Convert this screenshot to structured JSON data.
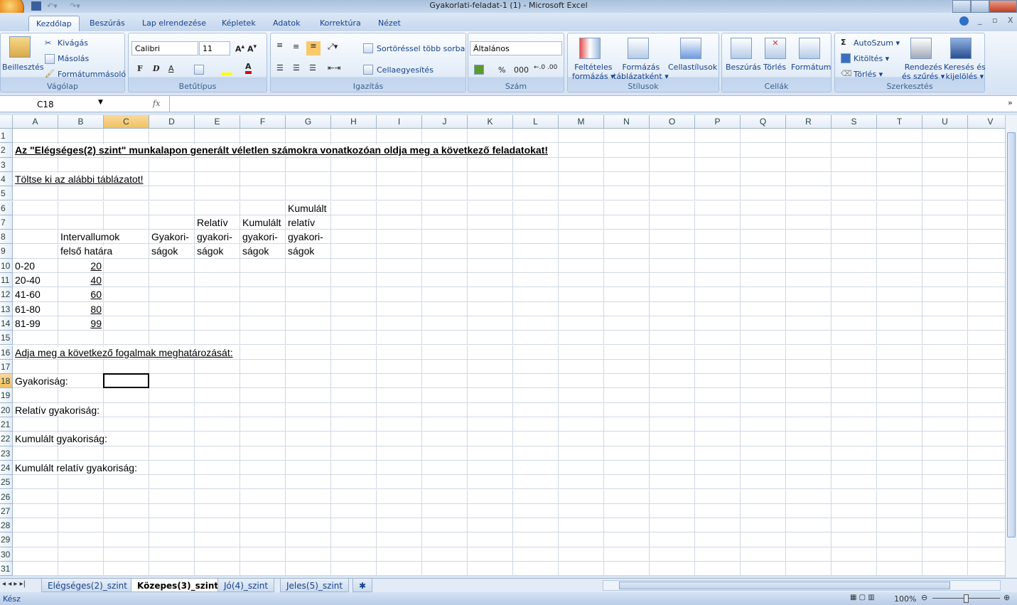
{
  "window": {
    "title": "Gyakorlati-feladat-1 (1) - Microsoft Excel"
  },
  "tabs": [
    {
      "label": "Kezdőlap",
      "active": true
    },
    {
      "label": "Beszúrás"
    },
    {
      "label": "Lap elrendezése"
    },
    {
      "label": "Képletek"
    },
    {
      "label": "Adatok"
    },
    {
      "label": "Korrektúra"
    },
    {
      "label": "Nézet"
    }
  ],
  "ribbon": {
    "clipboard": {
      "label": "Vágólap",
      "paste": "Beillesztés",
      "cut": "Kivágás",
      "copy": "Másolás",
      "format_painter": "Formátummásoló"
    },
    "font": {
      "label": "Betűtípus",
      "name": "Calibri",
      "size": "11",
      "bold": "F",
      "italic": "D",
      "underline": "A"
    },
    "alignment": {
      "label": "Igazítás",
      "wrap": "Sortöréssel több sorba",
      "merge": "Cellaegyesítés"
    },
    "number": {
      "label": "Szám",
      "format": "Általános",
      "percent": "%",
      "thousands": "000"
    },
    "styles": {
      "label": "Stílusok",
      "conditional": [
        "Feltételes",
        "formázás"
      ],
      "table": [
        "Formázás",
        "táblázatként"
      ],
      "cell": "Cellastílusok"
    },
    "cells": {
      "label": "Cellák",
      "insert": "Beszúrás",
      "delete": "Törlés",
      "format": "Formátum"
    },
    "editing": {
      "label": "Szerkesztés",
      "autosum": "AutoSzum",
      "fill": "Kitöltés",
      "clear": "Törlés",
      "sort": [
        "Rendezés",
        "és szűrés"
      ],
      "find": [
        "Keresés és",
        "kijelölés"
      ]
    }
  },
  "formula_bar": {
    "name_box": "C18",
    "fx": "fx",
    "value": ""
  },
  "columns": [
    "A",
    "B",
    "C",
    "D",
    "E",
    "F",
    "G",
    "H",
    "I",
    "J",
    "K",
    "L",
    "M",
    "N",
    "O",
    "P",
    "Q",
    "R",
    "S",
    "T",
    "U",
    "V"
  ],
  "selected_cell": "C18",
  "cells": [
    {
      "r": 2,
      "c": "A",
      "v": "Az \"Elégséges(2)  szint\"  munkalapon generált véletlen számokra vonatkozóan oldja meg a következő feladatokat!",
      "s": "b u"
    },
    {
      "r": 4,
      "c": "A",
      "v": "Töltse ki az alábbi táblázatot!",
      "s": "u"
    },
    {
      "r": 6,
      "c": "G",
      "v": "Kumulált"
    },
    {
      "r": 7,
      "c": "E",
      "v": "Relatív"
    },
    {
      "r": 7,
      "c": "F",
      "v": "Kumulált"
    },
    {
      "r": 7,
      "c": "G",
      "v": "relatív"
    },
    {
      "r": 8,
      "c": "B",
      "v": "Intervallumok"
    },
    {
      "r": 8,
      "c": "D",
      "v": "Gyakori-"
    },
    {
      "r": 8,
      "c": "E",
      "v": "gyakori-"
    },
    {
      "r": 8,
      "c": "F",
      "v": "gyakori-"
    },
    {
      "r": 8,
      "c": "G",
      "v": "gyakori-"
    },
    {
      "r": 9,
      "c": "B",
      "v": "felső határa"
    },
    {
      "r": 9,
      "c": "D",
      "v": "ságok"
    },
    {
      "r": 9,
      "c": "E",
      "v": "ságok"
    },
    {
      "r": 9,
      "c": "F",
      "v": "ságok"
    },
    {
      "r": 9,
      "c": "G",
      "v": "ságok"
    },
    {
      "r": 10,
      "c": "A",
      "v": "0-20"
    },
    {
      "r": 10,
      "c": "B",
      "v": "20",
      "s": "num"
    },
    {
      "r": 11,
      "c": "A",
      "v": "20-40"
    },
    {
      "r": 11,
      "c": "B",
      "v": "40",
      "s": "num"
    },
    {
      "r": 12,
      "c": "A",
      "v": "41-60"
    },
    {
      "r": 12,
      "c": "B",
      "v": "60",
      "s": "num"
    },
    {
      "r": 13,
      "c": "A",
      "v": "61-80"
    },
    {
      "r": 13,
      "c": "B",
      "v": "80",
      "s": "num"
    },
    {
      "r": 14,
      "c": "A",
      "v": "81-99"
    },
    {
      "r": 14,
      "c": "B",
      "v": "99",
      "s": "num"
    },
    {
      "r": 16,
      "c": "A",
      "v": "Adja meg a következő fogalmak meghatározását:",
      "s": "u"
    },
    {
      "r": 18,
      "c": "A",
      "v": "Gyakoriság:"
    },
    {
      "r": 20,
      "c": "A",
      "v": "Relatív gyakoriság:"
    },
    {
      "r": 22,
      "c": "A",
      "v": "Kumulált gyakoriság:"
    },
    {
      "r": 24,
      "c": "A",
      "v": "Kumulált relatív gyakoriság:"
    }
  ],
  "sheets": [
    {
      "label": "Elégséges(2)_szint"
    },
    {
      "label": "Közepes(3)_szint",
      "active": true
    },
    {
      "label": "Jó(4)_szint"
    },
    {
      "label": "Jeles(5)_szint"
    }
  ],
  "status": {
    "text": "Kész",
    "zoom": "100%"
  }
}
